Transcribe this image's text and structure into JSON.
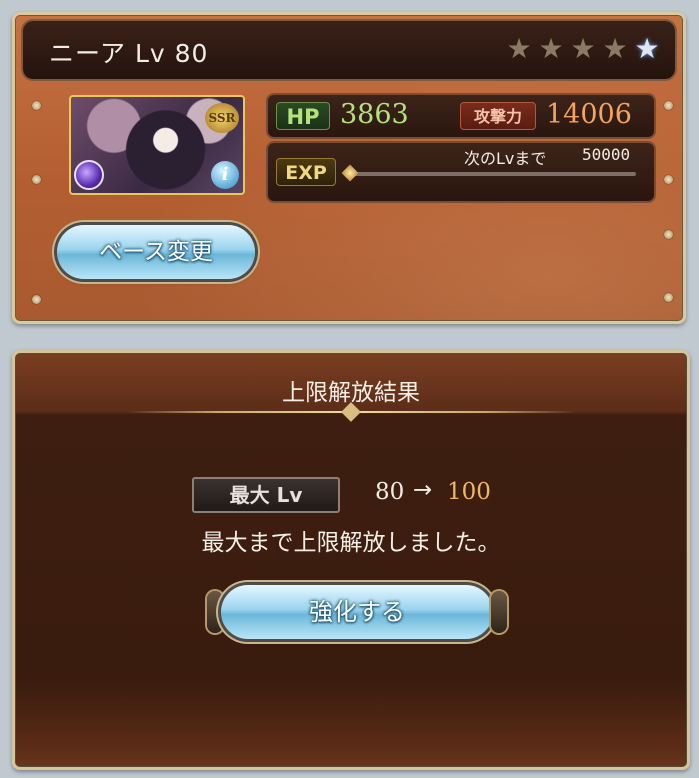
{
  "character": {
    "name_level": "ニーア Lv 80",
    "rarity": "SSR",
    "stars_filled": 4,
    "stars_total": 5,
    "hp_label": "HP",
    "hp": "3863",
    "atk_label": "攻撃力",
    "atk": "14006",
    "exp_label": "EXP",
    "exp_next_label": "次のLvまで",
    "exp_next_value": "50000",
    "exp_progress": 0.0,
    "base_change_label": "ベース変更"
  },
  "result": {
    "title": "上限解放結果",
    "max_lv_label": "最大 Lv",
    "lv_from": "80",
    "lv_arrow": "→",
    "lv_to": "100",
    "message": "最大まで上限解放しました。",
    "enhance_label": "強化する"
  },
  "colors": {
    "hp_value": "#b3e17b",
    "atk_value": "#f5a460",
    "lv_to": "#f1b766",
    "button_blue": "#9bd4ee"
  }
}
